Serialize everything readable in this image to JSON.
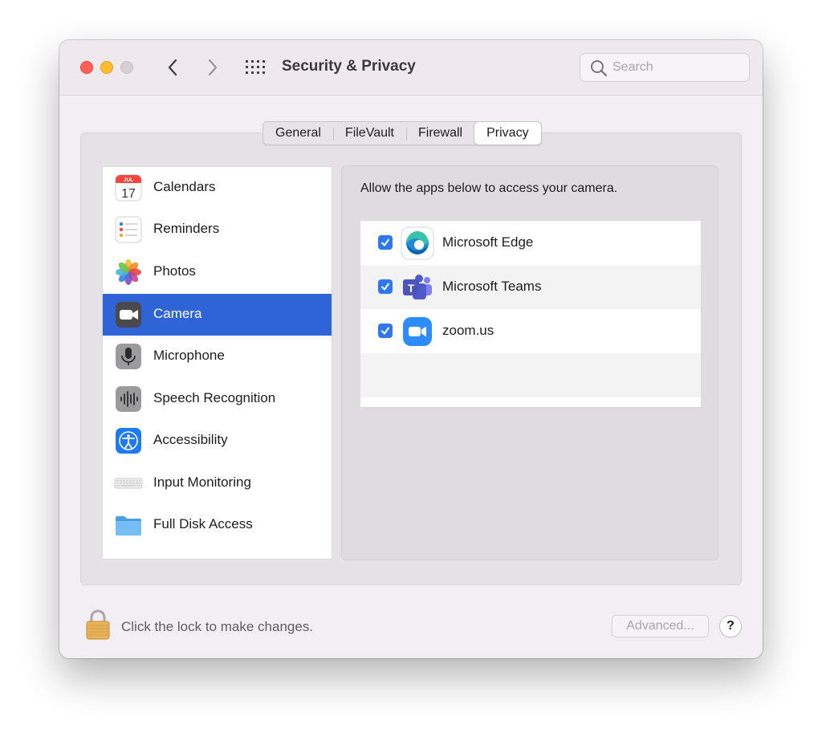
{
  "window": {
    "title": "Security & Privacy",
    "search_placeholder": "Search"
  },
  "tabs": [
    {
      "label": "General"
    },
    {
      "label": "FileVault"
    },
    {
      "label": "Firewall"
    },
    {
      "label": "Privacy",
      "active": true
    }
  ],
  "sidebar": {
    "items": [
      {
        "label": "Calendars",
        "icon": "calendar-icon",
        "calendar_month": "JUL",
        "calendar_day": "17"
      },
      {
        "label": "Reminders",
        "icon": "reminders-icon"
      },
      {
        "label": "Photos",
        "icon": "photos-icon"
      },
      {
        "label": "Camera",
        "icon": "camera-icon",
        "selected": true
      },
      {
        "label": "Microphone",
        "icon": "microphone-icon"
      },
      {
        "label": "Speech Recognition",
        "icon": "speech-recognition-icon"
      },
      {
        "label": "Accessibility",
        "icon": "accessibility-icon"
      },
      {
        "label": "Input Monitoring",
        "icon": "keyboard-icon"
      },
      {
        "label": "Full Disk Access",
        "icon": "folder-icon"
      }
    ]
  },
  "detail": {
    "description": "Allow the apps below to access your camera.",
    "apps": [
      {
        "name": "Microsoft Edge",
        "checked": true,
        "icon": "microsoft-edge-icon"
      },
      {
        "name": "Microsoft Teams",
        "checked": true,
        "icon": "microsoft-teams-icon",
        "icon_letter": "T"
      },
      {
        "name": "zoom.us",
        "checked": true,
        "icon": "zoom-icon"
      }
    ]
  },
  "footer": {
    "lock_text": "Click the lock to make changes.",
    "advanced_label": "Advanced...",
    "help_label": "?"
  },
  "colors": {
    "selection": "#2e64d6",
    "checkbox": "#2f77f1",
    "close": "#fe5f57",
    "minimize": "#febc2e"
  }
}
